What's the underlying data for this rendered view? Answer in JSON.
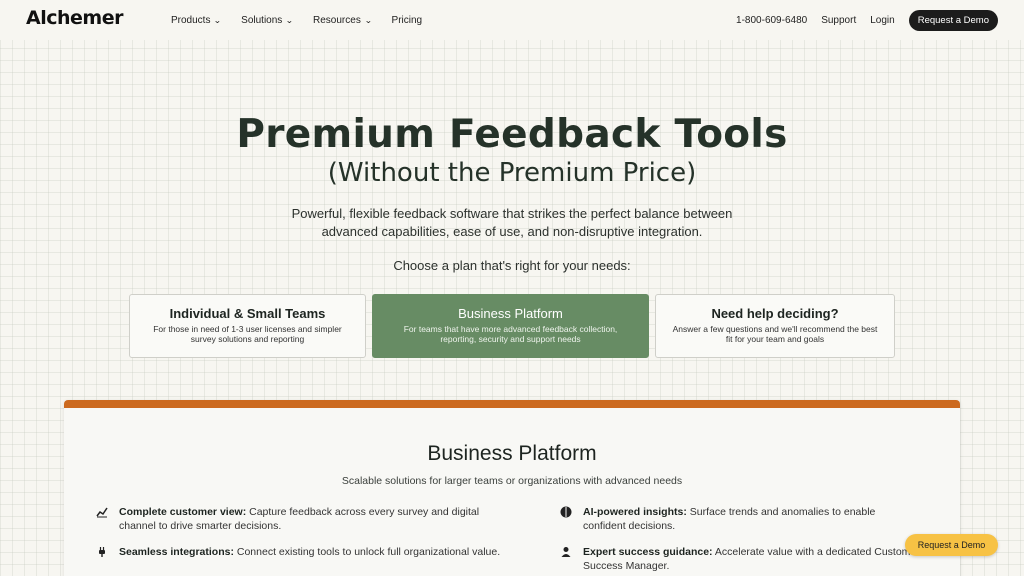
{
  "nav": {
    "logo": "Alchemer",
    "menu": [
      {
        "label": "Products"
      },
      {
        "label": "Solutions"
      },
      {
        "label": "Resources"
      },
      {
        "label": "Pricing"
      }
    ],
    "phone": "1-800-609-6480",
    "support": "Support",
    "login": "Login",
    "demo": "Request a Demo"
  },
  "hero": {
    "title": "Premium Feedback Tools",
    "subtitle": "(Without the Premium Price)",
    "description": "Powerful, flexible feedback software that strikes the perfect balance between advanced capabilities, ease of use, and non-disruptive integration.",
    "choose": "Choose a plan that's right for your needs:"
  },
  "plans": [
    {
      "title": "Individual & Small Teams",
      "desc": "For those in need of 1-3 user licenses and simpler survey solutions and reporting",
      "selected": false
    },
    {
      "title": "Business Platform",
      "desc": "For teams that have more advanced feedback collection, reporting, security and support needs",
      "selected": true
    },
    {
      "title": "Need help deciding?",
      "desc": "Answer a few questions and we'll recommend the best fit for your team and goals",
      "selected": false
    }
  ],
  "panel": {
    "accent_color": "#cc6a1f",
    "title": "Business Platform",
    "subtitle": "Scalable solutions for larger teams or organizations with advanced needs",
    "features": [
      {
        "icon": "chart-line-icon",
        "bold": "Complete customer view:",
        "text": " Capture feedback across every survey and digital channel to drive smarter decisions."
      },
      {
        "icon": "brain-icon",
        "bold": "AI-powered insights:",
        "text": " Surface trends and anomalies to enable confident decisions."
      },
      {
        "icon": "plug-icon",
        "bold": "Seamless integrations:",
        "text": " Connect existing tools to unlock full organizational value."
      },
      {
        "icon": "person-icon",
        "bold": "Expert success guidance:",
        "text": " Accelerate value with a dedicated Customer Success Manager."
      }
    ]
  },
  "float_demo": "Request a Demo",
  "colors": {
    "plan_active": "#678c64",
    "float_button": "#f7c244"
  }
}
